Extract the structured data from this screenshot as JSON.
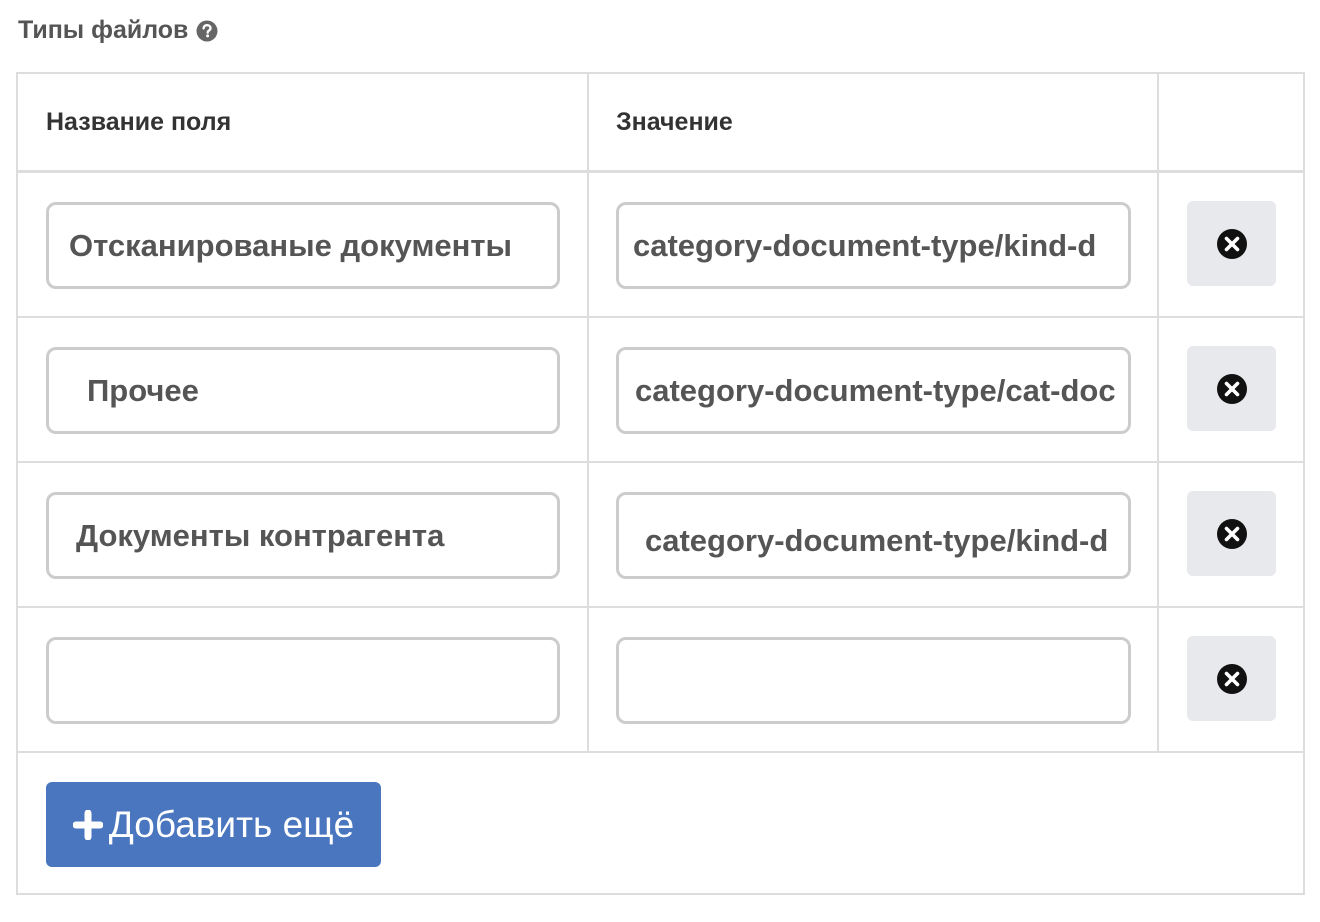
{
  "section": {
    "title": "Типы файлов",
    "help_icon": "question-circle-icon"
  },
  "table": {
    "columns": [
      "Название поля",
      "Значение",
      ""
    ],
    "rows": [
      {
        "name": "Отсканированые документы",
        "value": "category-document-type/kind-d",
        "delete_icon": "times-circle-icon"
      },
      {
        "name": "Прочее",
        "value": "category-document-type/cat-doc",
        "delete_icon": "times-circle-icon"
      },
      {
        "name": "Документы контрагента",
        "value": "category-document-type/kind-d",
        "delete_icon": "times-circle-icon"
      },
      {
        "name": "",
        "value": "",
        "delete_icon": "times-circle-icon"
      }
    ]
  },
  "add_button": {
    "label": "Добавить ещё",
    "icon": "plus-icon",
    "color": "#4a76bf"
  }
}
